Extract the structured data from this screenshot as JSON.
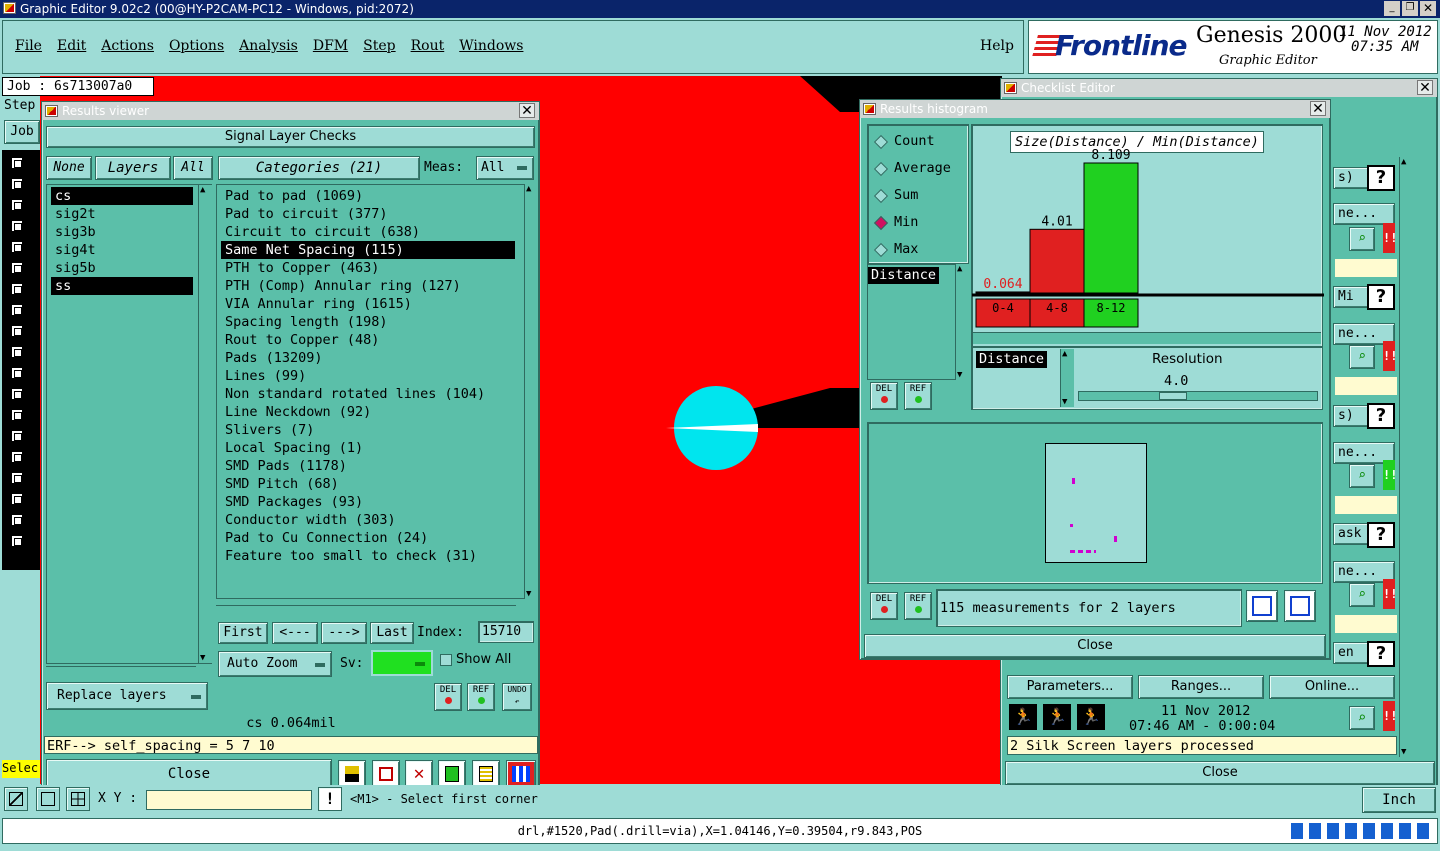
{
  "app": {
    "title": "Graphic Editor 9.02c2 (00@HY-P2CAM-PC12 - Windows, pid:2072)"
  },
  "menu": [
    "File",
    "Edit",
    "Actions",
    "Options",
    "Analysis",
    "DFM",
    "Step",
    "Rout",
    "Windows"
  ],
  "help": "Help",
  "brand": {
    "logo": "Frontline",
    "product": "Genesis 2000",
    "sub": "Graphic Editor",
    "date": "11 Nov 2012",
    "time": "07:35 AM"
  },
  "job": {
    "label": "Job : 6s713007a0",
    "step": "Step",
    "job_btn": "Job"
  },
  "results_viewer": {
    "title": "Results viewer",
    "header": "Signal Layer Checks",
    "none": "None",
    "layers": "Layers",
    "all": "All",
    "layer_items": [
      "cs",
      "sig2t",
      "sig3b",
      "sig4t",
      "sig5b",
      "ss"
    ],
    "categories_btn": "Categories (21)",
    "meas_label": "Meas:",
    "meas_value": "All",
    "categories": [
      "Pad to pad (1069)",
      "Pad to circuit (377)",
      "Circuit to circuit (638)",
      "Same Net Spacing (115)",
      "PTH to Copper (463)",
      "PTH (Comp) Annular ring (127)",
      "VIA Annular ring (1615)",
      "Spacing length (198)",
      "Rout to Copper (48)",
      "Pads (13209)",
      "Lines (99)",
      "Non standard rotated lines (104)",
      "Line Neckdown (92)",
      "Slivers (7)",
      "Local Spacing (1)",
      "SMD Pads (1178)",
      "SMD Pitch (68)",
      "SMD Packages (93)",
      "Conductor width (303)",
      "Pad to Cu Connection (24)",
      "Feature too small to check (31)"
    ],
    "first": "First",
    "prev": "<---",
    "next": "--->",
    "last": "Last",
    "index_label": "Index:",
    "index_value": "15710",
    "auto_zoom": "Auto Zoom",
    "sv_label": "Sv:",
    "show_all": "Show All",
    "replace_layers": "Replace layers",
    "del": "DEL",
    "ref": "REF",
    "undo": "UNDO",
    "status": "cs 0.064mil",
    "erf": "ERF--> self_spacing = 5 7 10",
    "close": "Close"
  },
  "histogram": {
    "title": "Results histogram",
    "modes": [
      "Count",
      "Average",
      "Sum",
      "Min",
      "Max"
    ],
    "selected_mode": "Min",
    "chart_title": "Size(Distance) / Min(Distance)",
    "field_item": "Distance",
    "bars": [
      {
        "value": "0.064",
        "range": "0-4",
        "color": "#e02020",
        "frac": 0.008
      },
      {
        "value": "4.01",
        "range": "4-8",
        "color": "#e02020",
        "frac": 0.49
      },
      {
        "value": "8.109",
        "range": "8-12",
        "color": "#20d020",
        "frac": 1.0
      }
    ],
    "res_field": "Distance",
    "resolution_label": "Resolution",
    "resolution_value": "4.0",
    "measurements": "115 measurements for 2 layers",
    "close": "Close",
    "del": "DEL",
    "ref": "REF"
  },
  "checklist": {
    "title": "Checklist Editor",
    "parameters": "Parameters...",
    "ranges": "Ranges...",
    "online": "Online...",
    "date": "11 Nov 2012",
    "time_line": "07:46 AM - 0:00:04",
    "processed": "2 Silk Screen layers processed",
    "close": "Close",
    "frag": [
      "s)",
      "ne...",
      "Mi",
      "ne...",
      "s)",
      "ne...",
      "ask",
      "ne...",
      "en"
    ]
  },
  "bottom": {
    "xy_label": "X Y :",
    "prompt": "<M1> - Select first corner",
    "unit": "Inch",
    "select": "Selec",
    "status": "drl,#1520,Pad(.drill=via),X=1.04146,Y=0.39504,r9.843,POS"
  },
  "colors": {
    "copper": "#ff0000",
    "panel": "#5bbfa9",
    "light": "#9edcd6",
    "pad": "#00e5ee"
  }
}
